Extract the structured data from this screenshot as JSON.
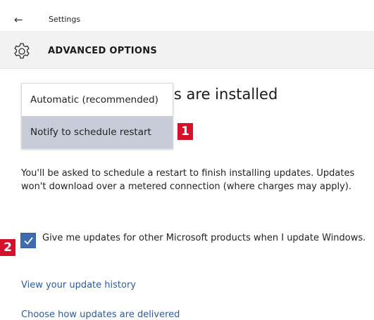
{
  "window": {
    "back_icon": "arrow-left-icon",
    "title": "Settings"
  },
  "header": {
    "icon": "gear-icon",
    "title": "ADVANCED OPTIONS"
  },
  "dropdown": {
    "options": [
      {
        "label": "Automatic (recommended)",
        "selected": false
      },
      {
        "label": "Notify to schedule restart",
        "selected": true
      }
    ],
    "highlight_color": "#c8ccd8"
  },
  "heading_partial": "es are installed",
  "badges": {
    "badge1": "1",
    "badge2": "2",
    "color": "#d6112a"
  },
  "description": "You'll be asked to schedule a restart to finish installing updates. Updates won't download over a metered connection (where charges may apply).",
  "checkbox": {
    "checked": true,
    "label": "Give me updates for other Microsoft products when I update Windows.",
    "accent_color": "#3f6bb0"
  },
  "links": {
    "update_history": "View your update history",
    "delivery": "Choose how updates are delivered",
    "color": "#2d5aa0"
  }
}
